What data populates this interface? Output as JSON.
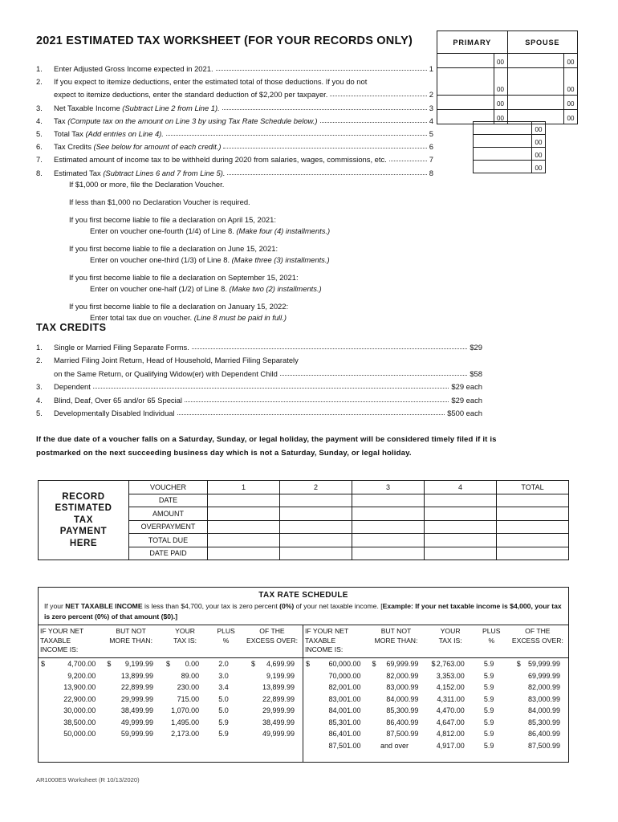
{
  "worksheet": {
    "title": "2021 ESTIMATED TAX WORKSHEET (FOR YOUR RECORDS ONLY)",
    "columns": {
      "primary": "PRIMARY",
      "spouse": "SPOUSE"
    },
    "cents": "00",
    "lines": [
      {
        "num": "1.",
        "text": "Enter Adjusted Gross Income expected in 2021.",
        "end": "1"
      },
      {
        "num": "2.",
        "text": "If you expect to itemize deductions, enter the estimated total of those deductions. If you do not",
        "end": ""
      },
      {
        "num": "",
        "text": "expect to itemize deductions, enter the standard deduction of $2,200 per taxpayer.",
        "end": "2"
      },
      {
        "num": "3.",
        "text": "Net Taxable Income ",
        "textItalic": "(Subtract Line 2 from Line 1).",
        "end": "3"
      },
      {
        "num": "4.",
        "text": "Tax ",
        "textItalic": "(Compute tax on the amount on Line 3 by using Tax Rate Schedule below.)",
        "end": "4"
      },
      {
        "num": "5.",
        "text": "Total Tax ",
        "textItalic": "(Add entries on Line 4).",
        "end": "5"
      },
      {
        "num": "6.",
        "text": "Tax Credits ",
        "textItalic": "(See below for amount of each credit.)",
        "end": "6"
      },
      {
        "num": "7.",
        "text": "Estimated amount of income tax to be withheld during 2020 from salaries, wages, commissions, etc.",
        "end": "7"
      },
      {
        "num": "8.",
        "text": "Estimated Tax ",
        "textItalic": "(Subtract Lines 6 and 7 from Line 5).",
        "end": "8"
      }
    ]
  },
  "voucher_instructions": [
    {
      "lead": "If $1,000 or more, file the Declaration Voucher.",
      "sub": "",
      "subItalic": ""
    },
    {
      "lead": "If less than $1,000 no Declaration Voucher is required.",
      "sub": "",
      "subItalic": ""
    },
    {
      "lead": "If you first become liable to file a declaration on April 15, 2021:",
      "sub": "Enter on voucher one-fourth (1/4) of Line 8. ",
      "subItalic": "(Make four (4) installments.)"
    },
    {
      "lead": "If you first become liable to file a declaration on June 15, 2021:",
      "sub": "Enter on voucher one-third (1/3) of Line 8. ",
      "subItalic": "(Make three (3) installments.)"
    },
    {
      "lead": "If you first become liable to file a declaration on September 15, 2021:",
      "sub": "Enter on voucher one-half (1/2) of Line 8. ",
      "subItalic": "(Make two (2) installments.)"
    },
    {
      "lead": "If you first become liable to file a declaration on January 15, 2022:",
      "sub": "Enter total tax due on voucher. ",
      "subItalic": "(Line 8 must be paid in full.)"
    }
  ],
  "tax_credits": {
    "title": "TAX CREDITS",
    "items": [
      {
        "num": "1.",
        "text": "Single or Married Filing Separate Forms.",
        "amount": "$29"
      },
      {
        "num": "2.",
        "text": "Married Filing Joint Return, Head of Household, Married Filing Separately",
        "amount": ""
      },
      {
        "num": "",
        "text": "on the Same Return, or Qualifying Widow(er) with Dependent Child",
        "amount": "$58"
      },
      {
        "num": "3.",
        "text": "Dependent",
        "amount": "$29 each"
      },
      {
        "num": "4.",
        "text": "Blind, Deaf, Over 65 and/or 65 Special",
        "amount": "$29 each"
      },
      {
        "num": "5.",
        "text": "Developmentally Disabled Individual",
        "amount": "$500 each"
      }
    ]
  },
  "due_date_note": {
    "line1": "If the due date of a voucher falls on a Saturday, Sunday, or legal holiday, the payment will be considered timely filed if it is",
    "line2": "postmarked on the next succeeding business day which is not a Saturday, Sunday, or legal holiday."
  },
  "record_table": {
    "label_lines": [
      "RECORD",
      "ESTIMATED",
      "TAX",
      "PAYMENT",
      "HERE"
    ],
    "row_labels": [
      "VOUCHER",
      "DATE",
      "AMOUNT",
      "OVERPAYMENT",
      "TOTAL DUE",
      "DATE PAID"
    ],
    "voucher_headers": [
      "1",
      "2",
      "3",
      "4",
      "TOTAL"
    ],
    "blank_cells": [
      "",
      "",
      "",
      "",
      ""
    ]
  },
  "rate_schedule": {
    "title": "TAX RATE SCHEDULE",
    "intro_part1": "If your ",
    "intro_bold1": "NET TAXABLE INCOME",
    "intro_part2": " is less than $4,700, your tax is zero percent ",
    "intro_bold2": "(0%)",
    "intro_part3": " of your net taxable income. [",
    "intro_bold3": "Example: If your net taxable income is $4,000, your tax is zero percent (0%) of that amount ($0).]",
    "headers": {
      "income": [
        "IF YOUR NET",
        "TAXABLE",
        "INCOME IS:"
      ],
      "but_not_more": [
        "BUT NOT",
        "MORE THAN:"
      ],
      "your_tax": [
        "YOUR",
        "TAX IS:"
      ],
      "plus": [
        "PLUS",
        "%"
      ],
      "excess": [
        "OF THE",
        "EXCESS OVER:"
      ]
    },
    "dollar_sign": "$",
    "left_rows": [
      {
        "income": "4,700.00",
        "but_not_more": "9,199.99",
        "your_tax": "0.00",
        "plus": "2.0",
        "excess": "4,699.99",
        "first": true
      },
      {
        "income": "9,200.00",
        "but_not_more": "13,899.99",
        "your_tax": "89.00",
        "plus": "3.0",
        "excess": "9,199.99",
        "first": false
      },
      {
        "income": "13,900.00",
        "but_not_more": "22,899.99",
        "your_tax": "230.00",
        "plus": "3.4",
        "excess": "13,899.99",
        "first": false
      },
      {
        "income": "22,900.00",
        "but_not_more": "29,999.99",
        "your_tax": "715.00",
        "plus": "5.0",
        "excess": "22,899.99",
        "first": false
      },
      {
        "income": "30,000.00",
        "but_not_more": "38,499.99",
        "your_tax": "1,070.00",
        "plus": "5.0",
        "excess": "29,999.99",
        "first": false
      },
      {
        "income": "38,500.00",
        "but_not_more": "49,999.99",
        "your_tax": "1,495.00",
        "plus": "5.9",
        "excess": "38,499.99",
        "first": false
      },
      {
        "income": "50,000.00",
        "but_not_more": "59,999.99",
        "your_tax": "2,173.00",
        "plus": "5.9",
        "excess": "49,999.99",
        "first": false
      }
    ],
    "right_rows": [
      {
        "income": "60,000.00",
        "but_not_more": "69,999.99",
        "your_tax": "2,763.00",
        "plus": "5.9",
        "excess": "59,999.99",
        "first": true
      },
      {
        "income": "70,000.00",
        "but_not_more": "82,000.99",
        "your_tax": "3,353.00",
        "plus": "5.9",
        "excess": "69,999.99",
        "first": false
      },
      {
        "income": "82,001.00",
        "but_not_more": "83,000.99",
        "your_tax": "4,152.00",
        "plus": "5.9",
        "excess": "82,000.99",
        "first": false
      },
      {
        "income": "83,001.00",
        "but_not_more": "84,000.99",
        "your_tax": "4,311.00",
        "plus": "5.9",
        "excess": "83,000.99",
        "first": false
      },
      {
        "income": "84,001.00",
        "but_not_more": "85,300.99",
        "your_tax": "4,470.00",
        "plus": "5.9",
        "excess": "84,000.99",
        "first": false
      },
      {
        "income": "85,301.00",
        "but_not_more": "86,400.99",
        "your_tax": "4,647.00",
        "plus": "5.9",
        "excess": "85,300.99",
        "first": false
      },
      {
        "income": "86,401.00",
        "but_not_more": "87,500.99",
        "your_tax": "4,812.00",
        "plus": "5.9",
        "excess": "86,400.99",
        "first": false
      },
      {
        "income": "87,501.00",
        "but_not_more": "and over",
        "your_tax": "4,917.00",
        "plus": "5.9",
        "excess": "87,500.99",
        "first": false,
        "andover": true
      }
    ]
  },
  "footer": "AR1000ES Worksheet  (R 10/13/2020)"
}
